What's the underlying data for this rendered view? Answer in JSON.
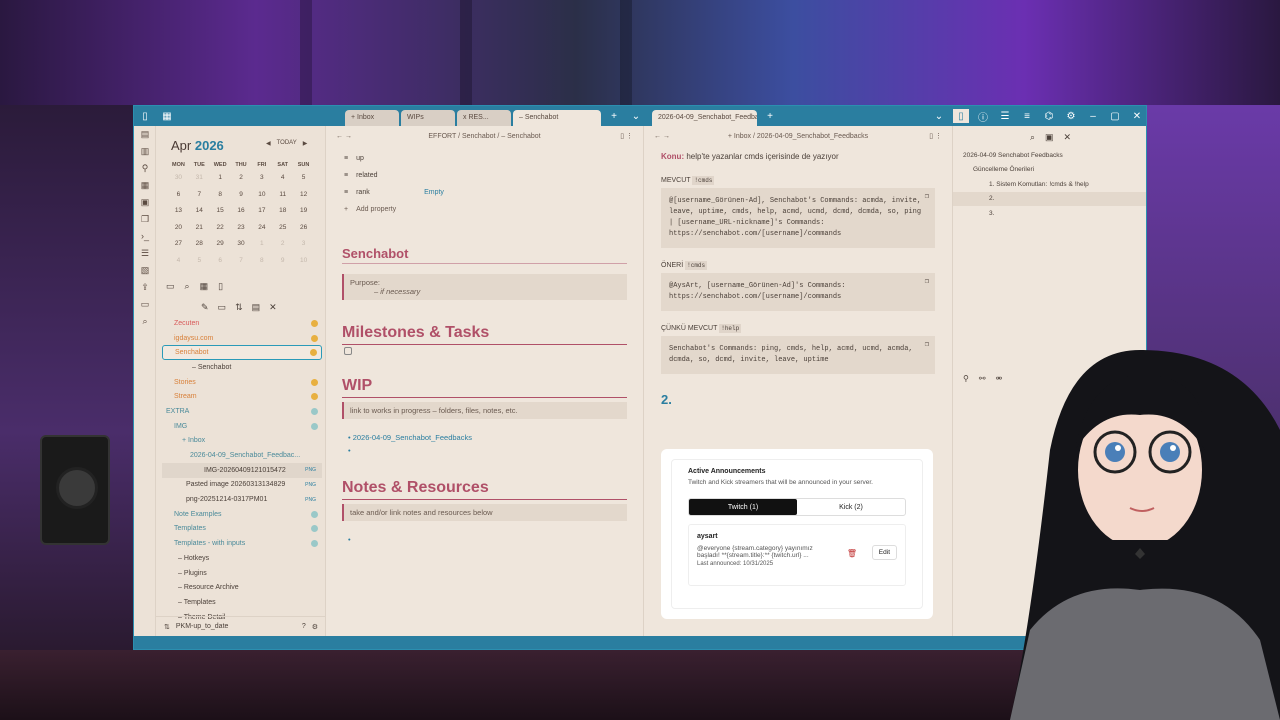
{
  "tabs_left": [
    {
      "label": "+ Inbox"
    },
    {
      "label": "WIPs"
    },
    {
      "label": "x RES..."
    },
    {
      "label": "– Senchabot"
    }
  ],
  "tabs_right": [
    {
      "label": "2026-04-09_Senchabot_Feedbac..."
    }
  ],
  "calendar": {
    "month": "Apr",
    "year": "2026",
    "today": "TODAY",
    "dow": [
      "MON",
      "TUE",
      "WED",
      "THU",
      "FRI",
      "SAT",
      "SUN"
    ],
    "weeks": [
      [
        "30",
        "31",
        "1",
        "2",
        "3",
        "4",
        "5"
      ],
      [
        "6",
        "7",
        "8",
        "9",
        "10",
        "11",
        "12"
      ],
      [
        "13",
        "14",
        "15",
        "16",
        "17",
        "18",
        "19"
      ],
      [
        "20",
        "21",
        "22",
        "23",
        "24",
        "25",
        "26"
      ],
      [
        "27",
        "28",
        "29",
        "30",
        "1",
        "2",
        "3"
      ],
      [
        "4",
        "5",
        "6",
        "7",
        "8",
        "9",
        "10"
      ]
    ]
  },
  "tree": [
    {
      "label": "Zecuten",
      "indent": 12,
      "color": "#d85a5a",
      "dot": "#e8b040"
    },
    {
      "label": "igdaysu.com",
      "indent": 12,
      "color": "#d8803a",
      "dot": "#e8b040"
    },
    {
      "label": "Senchabot",
      "indent": 12,
      "color": "#d8803a",
      "dot": "#e8b040",
      "sel": true
    },
    {
      "label": "– Senchabot",
      "indent": 30,
      "color": "#4a3f38"
    },
    {
      "label": "Stories",
      "indent": 12,
      "color": "#d8803a",
      "dot": "#e8b040"
    },
    {
      "label": "Stream",
      "indent": 12,
      "color": "#d8803a",
      "dot": "#e8b040"
    },
    {
      "label": "EXTRA",
      "indent": 4,
      "color": "#4a8a9a",
      "dot": "#9ac8c8"
    },
    {
      "label": "IMG",
      "indent": 12,
      "color": "#4a8a9a",
      "dot": "#9ac8c8"
    },
    {
      "label": "+ Inbox",
      "indent": 20,
      "color": "#4a8a9a"
    },
    {
      "label": "2026-04-09_Senchabot_Feedbac...",
      "indent": 28,
      "color": "#4a8a9a"
    },
    {
      "label": "IMG-20260409121015472",
      "indent": 42,
      "color": "#4a3f38",
      "badge": "PNG",
      "hl": true
    },
    {
      "label": "Pasted image 20260313134829",
      "indent": 24,
      "color": "#4a3f38",
      "badge": "PNG"
    },
    {
      "label": "png-20251214-0317PM01",
      "indent": 24,
      "color": "#4a3f38",
      "badge": "PNG"
    },
    {
      "label": "Note Examples",
      "indent": 12,
      "color": "#4a8a9a",
      "dot": "#9ac8c8"
    },
    {
      "label": "Templates",
      "indent": 12,
      "color": "#4a8a9a",
      "dot": "#9ac8c8"
    },
    {
      "label": "Templates - with inputs",
      "indent": 12,
      "color": "#4a8a9a",
      "dot": "#9ac8c8"
    },
    {
      "label": "– Hotkeys",
      "indent": 16,
      "color": "#4a3f38"
    },
    {
      "label": "– Plugins",
      "indent": 16,
      "color": "#4a3f38"
    },
    {
      "label": "– Resource Archive",
      "indent": 16,
      "color": "#4a3f38"
    },
    {
      "label": "– Templates",
      "indent": 16,
      "color": "#4a3f38"
    },
    {
      "label": "– Theme Detail",
      "indent": 16,
      "color": "#4a3f38"
    }
  ],
  "footer": {
    "vault": "PKM-up_to_date"
  },
  "left_pane": {
    "breadcrumb": "EFFORT / Senchabot / – Senchabot",
    "props": [
      {
        "key": "up",
        "value": ""
      },
      {
        "key": "related",
        "value": ""
      },
      {
        "key": "rank",
        "value": "Empty"
      }
    ],
    "add_property": "Add property",
    "title": "Senchabot",
    "purpose_label": "Purpose:",
    "purpose_value": "– if necessary",
    "h_milestones": "Milestones & Tasks",
    "h_wip": "WIP",
    "wip_callout": "link to works in progress – folders, files, notes, etc.",
    "wip_link": "2026-04-09_Senchabot_Feedbacks",
    "h_notes": "Notes & Resources",
    "notes_callout": "take and/or link notes and resources below"
  },
  "right_pane": {
    "breadcrumb": "+ Inbox / 2026-04-09_Senchabot_Feedbacks",
    "konu_label": "Konu:",
    "konu_text": "help'te yazanlar cmds içerisinde de yazıyor",
    "mevcut_label": "MEVCUT",
    "mevcut_kw": "!cmds",
    "mevcut_code": "@[username_Görünen-Ad], Senchabot's Commands: acmda, invite, leave, uptime, cmds, help, acmd, ucmd, dcmd, dcmda, so, ping | [username_URL-nickname]'s Commands: https://senchabot.com/[username]/commands",
    "oneri_label": "ÖNERİ",
    "oneri_kw": "!cmds",
    "oneri_code": "@AysArt, [username_Görünen-Ad]'s Commands: https://senchabot.com/[username]/commands",
    "cunku_label": "ÇÜNKÜ MEVCUT",
    "cunku_kw": "!help",
    "cunku_code": "Senchabot's Commands: ping, cmds, help, acmd, ucmd, acmda, dcmda, so, dcmd, invite, leave, uptime",
    "h2": "2.",
    "card": {
      "title": "Active Announcements",
      "subtitle": "Twitch and Kick streamers that will be announced in your server.",
      "tab1": "Twitch (1)",
      "tab2": "Kick (2)",
      "user": "aysart",
      "msg1": "@everyone {stream.category} yayınımız",
      "msg2": "başladı! **{stream.title}:** {twitch.url} ...",
      "last": "Last announced: 10/31/2025",
      "edit": "Edit"
    }
  },
  "outline": {
    "items": [
      {
        "label": "2026-04-09 Senchabot Feedbacks",
        "indent": 10
      },
      {
        "label": "Güncelleme Önerileri",
        "indent": 20
      },
      {
        "label": "1. Sistem Komutları: !cmds & !help",
        "indent": 36
      },
      {
        "label": "2.",
        "indent": 36
      },
      {
        "label": "3.",
        "indent": 36
      }
    ]
  }
}
